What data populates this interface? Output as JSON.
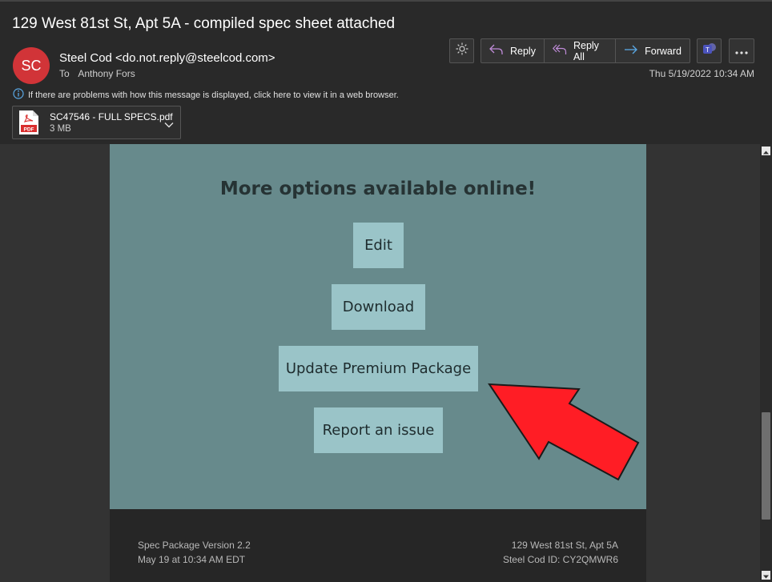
{
  "email": {
    "subject": "129 West 81st St, Apt 5A - compiled spec sheet attached",
    "avatar_initials": "SC",
    "sender": "Steel Cod <do.not.reply@steelcod.com>",
    "to_label": "To",
    "to_name": "Anthony Fors",
    "date": "Thu 5/19/2022 10:34 AM",
    "info_text": "If there are problems with how this message is displayed, click here to view it in a web browser."
  },
  "toolbar": {
    "reply_label": "Reply",
    "reply_all_label": "Reply All",
    "forward_label": "Forward"
  },
  "attachment": {
    "name": "SC47546 - FULL SPECS.pdf",
    "size": "3 MB",
    "icon_text": "PDF"
  },
  "content": {
    "title": "More options available online!",
    "buttons": {
      "edit": "Edit",
      "download": "Download",
      "update": "Update Premium Package",
      "report": "Report an issue"
    }
  },
  "footer": {
    "version": "Spec Package Version 2.2",
    "timestamp": "May 19 at 10:34 AM EDT",
    "address": "129 West 81st St, Apt 5A",
    "id": "Steel Cod ID: CY2QMWR6"
  },
  "colors": {
    "avatar": "#d13438",
    "panel": "#678a8c",
    "button": "#9ac4c8",
    "arrow": "#ff1d25"
  },
  "icons": [
    "sun-icon",
    "reply-icon",
    "reply-all-icon",
    "forward-icon",
    "teams-icon",
    "more-icon",
    "info-icon",
    "pdf-icon",
    "chevron-down-icon"
  ]
}
